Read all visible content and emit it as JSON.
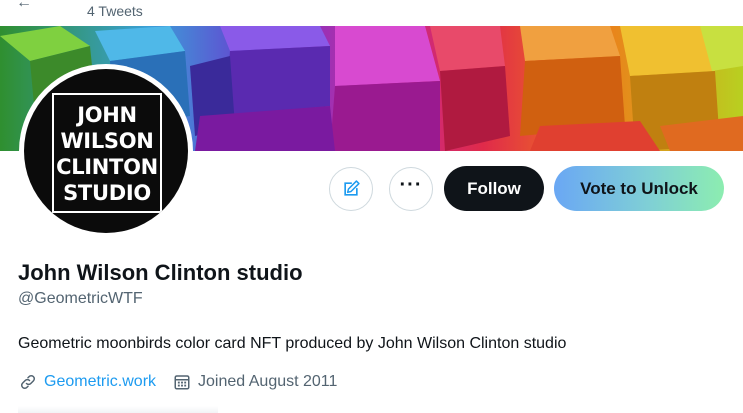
{
  "header": {
    "tweet_count": "4 Tweets"
  },
  "profile": {
    "avatar_logo_lines": [
      "JOHN",
      "WILSON",
      "CLINTON",
      "STUDIO"
    ],
    "display_name": "John Wilson Clinton studio",
    "handle": "@GeometricWTF",
    "bio": "Geometric moonbirds color card NFT  produced by John Wilson Clinton studio",
    "website": "Geometric.work",
    "joined": "Joined August 2011"
  },
  "actions": {
    "edit_icon": "edit-icon",
    "more_icon": "more-icon",
    "follow_label": "Follow",
    "vote_label": "Vote to Unlock"
  },
  "icons": {
    "link": "link-icon",
    "calendar": "calendar-icon"
  },
  "colors": {
    "accent": "#1d9bf0",
    "follow_bg": "#0f1419",
    "vote_gradient_start": "#6aa7f4",
    "vote_gradient_end": "#8cedb0",
    "secondary_text": "#536471"
  }
}
